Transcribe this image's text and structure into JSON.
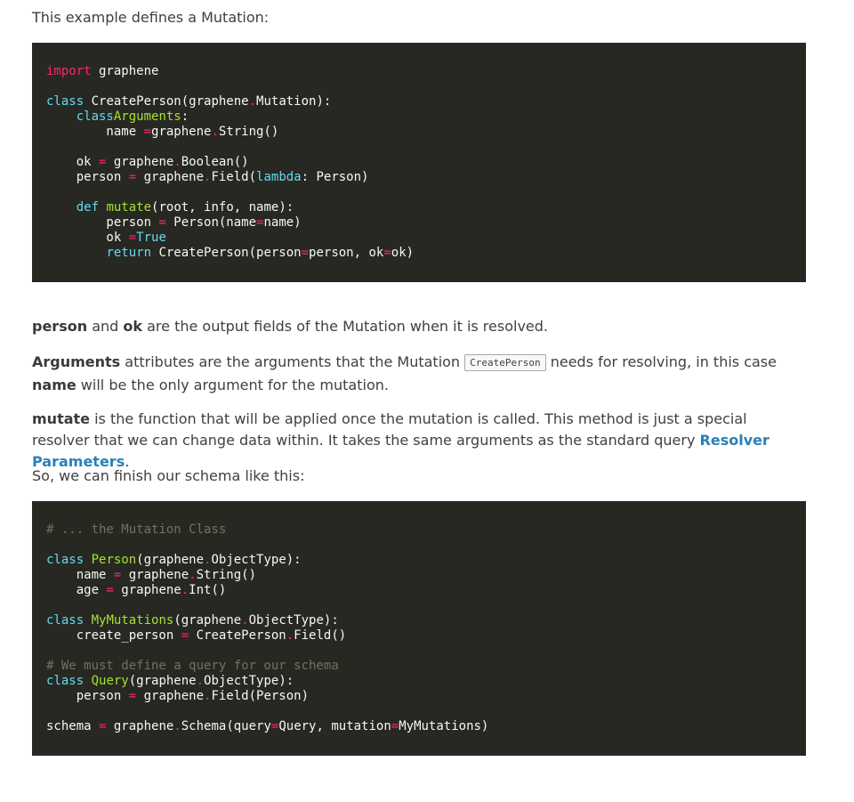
{
  "intro": "This example defines a Mutation:",
  "code1": {
    "lines": [
      [
        [
          "imp",
          "import"
        ],
        [
          "",
          "graphene"
        ]
      ],
      [],
      [
        [
          "kw",
          "class"
        ],
        [
          "",
          "CreatePerson"
        ],
        [
          "",
          "(graphene"
        ],
        [
          "op",
          "."
        ],
        [
          "",
          "Mutation):"
        ]
      ],
      [
        [
          "",
          "    "
        ],
        [
          "kw",
          "class"
        ],
        [
          "",
          ""
        ],
        [
          "cls",
          "Arguments"
        ],
        [
          "",
          ":"
        ]
      ],
      [
        [
          "",
          "        name "
        ],
        [
          "op",
          "="
        ],
        [
          "",
          ""
        ],
        [
          "",
          "graphene"
        ],
        [
          "op",
          "."
        ],
        [
          "",
          "String()"
        ]
      ],
      [],
      [
        [
          "",
          "    ok "
        ],
        [
          "op",
          "="
        ],
        [
          "",
          "graphene"
        ],
        [
          "op",
          "."
        ],
        [
          "",
          "Boolean()"
        ]
      ],
      [
        [
          "",
          "    person "
        ],
        [
          "op",
          "="
        ],
        [
          "",
          "graphene"
        ],
        [
          "op",
          "."
        ],
        [
          "",
          "Field("
        ],
        [
          "kw",
          "lambda"
        ],
        [
          "",
          ": Person)"
        ]
      ],
      [],
      [
        [
          "",
          "    "
        ],
        [
          "kw",
          "def"
        ],
        [
          "fn",
          "mutate"
        ],
        [
          "",
          "(root, info, name):"
        ]
      ],
      [
        [
          "",
          "        person "
        ],
        [
          "op",
          "="
        ],
        [
          "",
          "Person(name"
        ],
        [
          "op",
          "="
        ],
        [
          "",
          "name)"
        ]
      ],
      [
        [
          "",
          "        ok "
        ],
        [
          "op",
          "="
        ],
        [
          "kw",
          "True"
        ]
      ],
      [
        [
          "",
          "        "
        ],
        [
          "kw",
          "return"
        ],
        [
          "",
          "CreatePerson(person"
        ],
        [
          "op",
          "="
        ],
        [
          "",
          "person, ok"
        ],
        [
          "op",
          "="
        ],
        [
          "",
          "ok)"
        ]
      ]
    ]
  },
  "p1": {
    "b1": "person",
    "t1": " and ",
    "b2": "ok",
    "t2": " are the output fields of the Mutation when it is resolved."
  },
  "p2": {
    "b1": "Arguments",
    "t1": " attributes are the arguments that the Mutation ",
    "code": "CreatePerson",
    "t2": " needs for resolving, in this case ",
    "b2": "name",
    "t3": " will be the only argument for the mutation."
  },
  "p3": {
    "b1": "mutate",
    "t1": " is the function that will be applied once the mutation is called. This method is just a special resolver that we can change data within. It takes the same arguments as the standard query ",
    "link": "Resolver Parameters",
    "t2": "."
  },
  "p4": "So, we can finish our schema like this:",
  "code2": {
    "lines": [
      [
        [
          "cm",
          "# ... the Mutation Class"
        ]
      ],
      [],
      [
        [
          "kw",
          "class"
        ],
        [
          "cls",
          "Person"
        ],
        [
          "",
          "(graphene"
        ],
        [
          "op",
          "."
        ],
        [
          "",
          "ObjectType):"
        ]
      ],
      [
        [
          "",
          "    name "
        ],
        [
          "op",
          "="
        ],
        [
          "",
          "graphene"
        ],
        [
          "op",
          "."
        ],
        [
          "",
          "String()"
        ]
      ],
      [
        [
          "",
          "    age "
        ],
        [
          "op",
          "="
        ],
        [
          "",
          "graphene"
        ],
        [
          "op",
          "."
        ],
        [
          "",
          "Int()"
        ]
      ],
      [],
      [
        [
          "kw",
          "class"
        ],
        [
          "cls",
          "MyMutations"
        ],
        [
          "",
          "(graphene"
        ],
        [
          "op",
          "."
        ],
        [
          "",
          "ObjectType):"
        ]
      ],
      [
        [
          "",
          "    create_person "
        ],
        [
          "op",
          "="
        ],
        [
          "",
          "CreatePerson"
        ],
        [
          "op",
          "."
        ],
        [
          "",
          "Field()"
        ]
      ],
      [],
      [
        [
          "cm",
          "# We must define a query for our schema"
        ]
      ],
      [
        [
          "kw",
          "class"
        ],
        [
          "cls",
          "Query"
        ],
        [
          "",
          "(graphene"
        ],
        [
          "op",
          "."
        ],
        [
          "",
          "ObjectType):"
        ]
      ],
      [
        [
          "",
          "    person "
        ],
        [
          "op",
          "="
        ],
        [
          "",
          "graphene"
        ],
        [
          "op",
          "."
        ],
        [
          "",
          "Field(Person)"
        ]
      ],
      [],
      [
        [
          "",
          "schema "
        ],
        [
          "op",
          "="
        ],
        [
          "",
          "graphene"
        ],
        [
          "op",
          "."
        ],
        [
          "",
          "Schema(query"
        ],
        [
          "op",
          "="
        ],
        [
          "",
          "Query, mutation"
        ],
        [
          "op",
          "="
        ],
        [
          "",
          "MyMutations)"
        ]
      ]
    ]
  }
}
